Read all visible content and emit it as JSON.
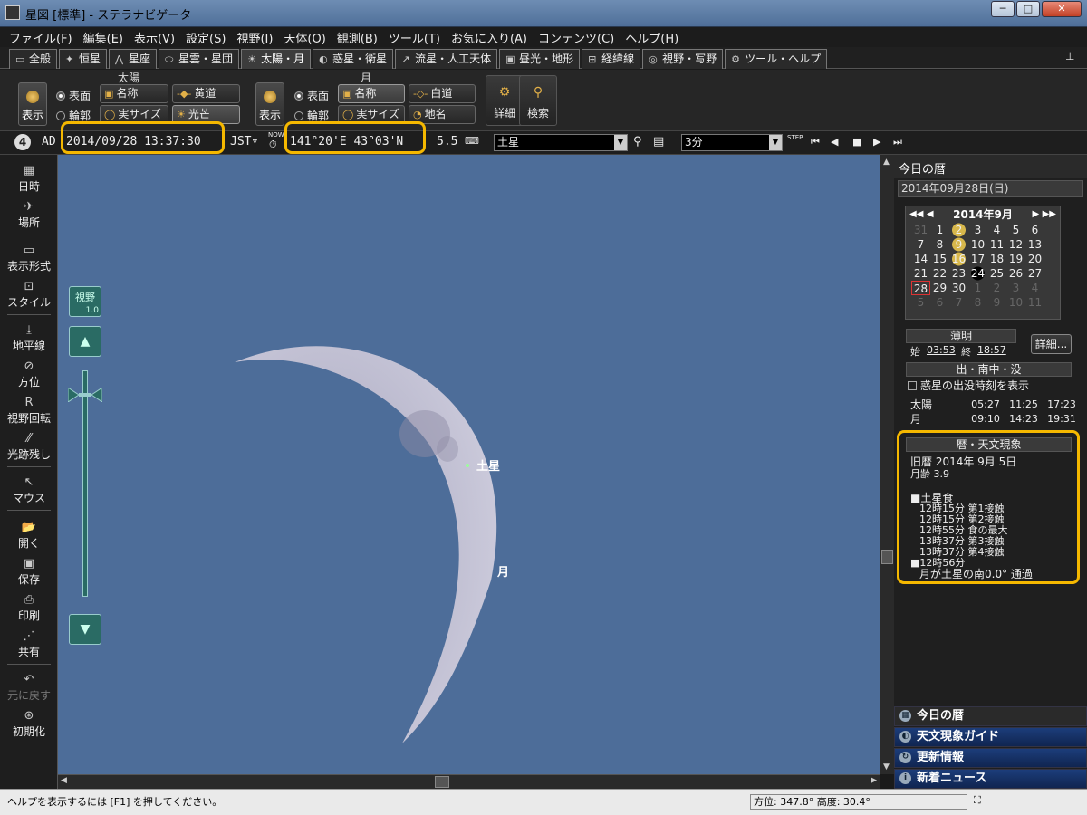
{
  "window": {
    "title": "星図 [標準] - ステラナビゲータ",
    "min": "─",
    "max": "□",
    "close": "✕"
  },
  "menu": [
    "ファイル(F)",
    "編集(E)",
    "表示(V)",
    "設定(S)",
    "視野(I)",
    "天体(O)",
    "観測(B)",
    "ツール(T)",
    "お気に入り(A)",
    "コンテンツ(C)",
    "ヘルプ(H)"
  ],
  "tabs": [
    {
      "label": "全般",
      "icon": "▭"
    },
    {
      "label": "恒星",
      "icon": "✦"
    },
    {
      "label": "星座",
      "icon": "⋀"
    },
    {
      "label": "星雲・星団",
      "icon": "⬭"
    },
    {
      "label": "太陽・月",
      "icon": "☀"
    },
    {
      "label": "惑星・衛星",
      "icon": "◐"
    },
    {
      "label": "流星・人工天体",
      "icon": "↗"
    },
    {
      "label": "昼光・地形",
      "icon": "▣"
    },
    {
      "label": "経緯線",
      "icon": "⊞"
    },
    {
      "label": "視野・写野",
      "icon": "◎"
    },
    {
      "label": "ツール・ヘルプ",
      "icon": "⚙"
    }
  ],
  "ribbon": {
    "sun_group": "太陽",
    "moon_group": "月",
    "show": "表示",
    "surface": "表面",
    "outline": "輪郭",
    "name": "名称",
    "realsize": "実サイズ",
    "ecliptic": "黄道",
    "glare": "光芒",
    "moonpath": "白道",
    "placename": "地名",
    "detail": "詳細",
    "search": "検索"
  },
  "status": {
    "era_icon": "4",
    "era": "AD",
    "datetime": "2014/09/28 13:37:30",
    "tz": "JST▿",
    "now": "NOW",
    "location": "141°20'E 43°03'N",
    "magnitude": "5.5",
    "object": "土星",
    "step": "3分",
    "step_label": "STEP"
  },
  "left_toolbar": [
    "日時",
    "場所",
    "表示形式",
    "スタイル",
    "地平線",
    "方位",
    "視野回転",
    "光跡残し",
    "マウス",
    "開く",
    "保存",
    "印刷",
    "共有",
    "元に戻す",
    "初期化"
  ],
  "sky": {
    "fov_label": "視野",
    "fov_value": "1.0",
    "saturn_label": "土星",
    "moon_label": "月"
  },
  "right_panel": {
    "title": "今日の暦",
    "date": "2014年09月28日(日)",
    "calendar": {
      "month": "2014年9月",
      "nav_prev": "◀◀ ◀",
      "nav_next": "▶ ▶▶",
      "days": [
        "31",
        "1",
        "2",
        "3",
        "4",
        "5",
        "6",
        "7",
        "8",
        "9",
        "10",
        "11",
        "12",
        "13",
        "14",
        "15",
        "16",
        "17",
        "18",
        "19",
        "20",
        "21",
        "22",
        "23",
        "24",
        "25",
        "26",
        "27",
        "28",
        "29",
        "30",
        "1",
        "2",
        "3",
        "4",
        "5",
        "6",
        "7",
        "8",
        "9",
        "10",
        "11"
      ]
    },
    "twilight_label": "薄明",
    "twilight_start_label": "始",
    "twilight_start": "03:53",
    "twilight_end_label": "終",
    "twilight_end": "18:57",
    "detail_btn": "詳細...",
    "rise_set_label": "出・南中・没",
    "planet_checkbox": "惑星の出没時刻を表示",
    "rise_set": [
      {
        "name": "太陽",
        "rise": "05:27",
        "transit": "11:25",
        "set": "17:23"
      },
      {
        "name": "月",
        "rise": "09:10",
        "transit": "14:23",
        "set": "19:31"
      }
    ],
    "phenomena_label": "暦・天文現象",
    "old_calendar": "旧暦 2014年 9月 5日",
    "moon_age": "月齢 3.9",
    "events": [
      "■土星食",
      "12時15分 第1接触",
      "12時15分 第2接触",
      "12時55分 食の最大",
      "13時37分 第3接触",
      "13時37分 第4接触",
      "■12時56分",
      "月が土星の南0.0° 通過"
    ],
    "bottom_nav": [
      "今日の暦",
      "天文現象ガイド",
      "更新情報",
      "新着ニュース"
    ]
  },
  "footer": {
    "help": "ヘルプを表示するには [F1] を押してください。",
    "coords": "方位: 347.8° 高度: 30.4°"
  },
  "colors": {
    "sky": "#4d6d99",
    "highlight": "#f5b800",
    "moon_light": "#c9c6d6"
  }
}
